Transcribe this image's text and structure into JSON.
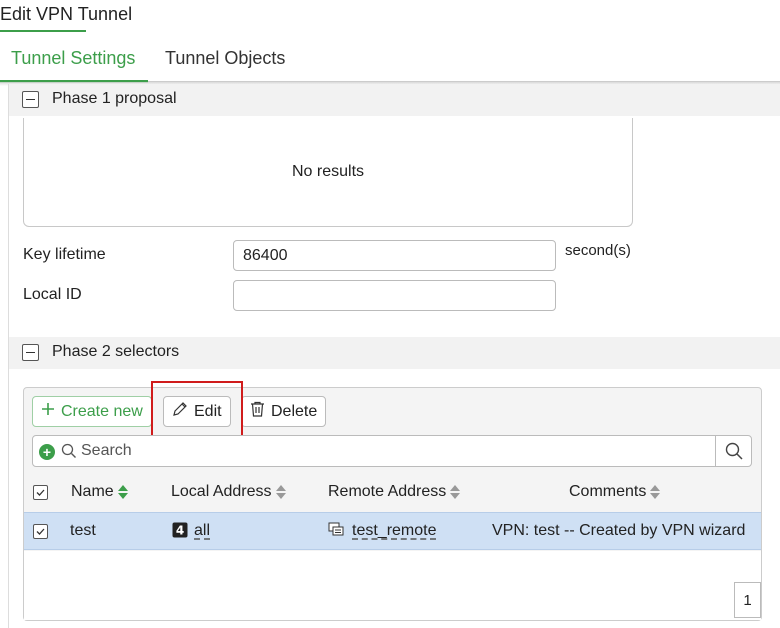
{
  "window": {
    "title": "Edit VPN Tunnel"
  },
  "tabs": [
    {
      "label": "Tunnel Settings",
      "active": true
    },
    {
      "label": "Tunnel Objects",
      "active": false
    }
  ],
  "phase1": {
    "header": "Phase 1 proposal",
    "empty_text": "No results",
    "key_lifetime_label": "Key lifetime",
    "key_lifetime_value": "86400",
    "key_lifetime_unit": "second(s)",
    "local_id_label": "Local ID",
    "local_id_value": ""
  },
  "phase2": {
    "header": "Phase 2 selectors",
    "toolbar": {
      "create_label": "Create new",
      "edit_label": "Edit",
      "delete_label": "Delete"
    },
    "search": {
      "placeholder": "Search"
    },
    "columns": [
      "Name",
      "Local Address",
      "Remote Address",
      "Comments"
    ],
    "rows": [
      {
        "name": "test",
        "local_badge": "4",
        "local_address": "all",
        "remote_address": "test_remote",
        "comments": "VPN: test -- Created by VPN wizard"
      }
    ],
    "page": "1"
  },
  "colors": {
    "accent": "#3c9e4a",
    "selected_row": "#cfe0f4",
    "highlight": "#d01c1c"
  },
  "icons": [
    "plus-icon",
    "pencil-icon",
    "trash-icon",
    "search-icon",
    "add-filter-icon",
    "sort-icon",
    "checkbox-icon",
    "address-icon",
    "address-group-icon"
  ]
}
